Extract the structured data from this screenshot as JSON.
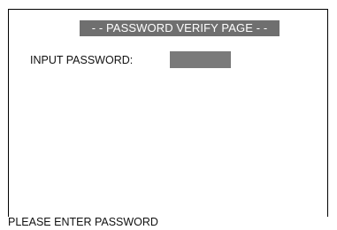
{
  "header": {
    "title": "- - PASSWORD VERIFY PAGE - -"
  },
  "form": {
    "password_label": "INPUT PASSWORD:",
    "password_value": ""
  },
  "status": {
    "message": "PLEASE ENTER PASSWORD"
  },
  "colors": {
    "title_bar_bg": "#6f6f6f",
    "title_text": "#ffffff",
    "input_bg": "#7a7a7a",
    "border": "#000000",
    "text": "#111111"
  }
}
